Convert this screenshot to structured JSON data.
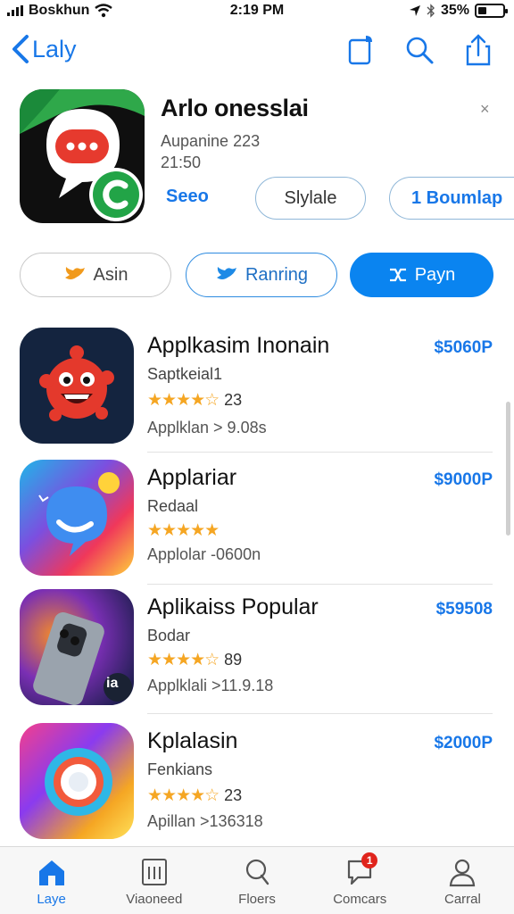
{
  "status_bar": {
    "carrier": "Boskhun",
    "time": "2:19 PM",
    "battery": "35%",
    "battery_level": 0.35,
    "icons": [
      "signal-icon",
      "wifi-icon",
      "location-icon",
      "bluetooth-icon",
      "battery-icon"
    ]
  },
  "nav": {
    "back_label": "Laly",
    "icons": [
      "compose-icon",
      "search-icon",
      "share-icon"
    ]
  },
  "hero": {
    "title": "Arlo onesslai",
    "subtitle_line1": "Aupanine 223",
    "subtitle_line2": "21:50",
    "see_label": "Seeo",
    "style_label": "Slylale",
    "third_label": "1 Boumlap",
    "dismiss": "×"
  },
  "segments": [
    {
      "label": "Asin",
      "icon": "bird-icon"
    },
    {
      "label": "Ranring",
      "icon": "bird-icon"
    },
    {
      "label": "Payn",
      "icon": "shuffle-icon"
    }
  ],
  "apps": [
    {
      "title": "Applkasim Inonain",
      "subtitle": "Saptkeial1",
      "stars": "★★★★☆",
      "rating": 4,
      "reviews": "23",
      "meta": "Applklan > 9.08s",
      "price": "$5060P"
    },
    {
      "title": "Applariar",
      "subtitle": "Redaal",
      "stars": "★★★★★",
      "rating": 5,
      "reviews": "",
      "meta": "Applolar -0600n",
      "price": "$9000P"
    },
    {
      "title": "Aplikaiss Popular",
      "subtitle": "Bodar",
      "stars": "★★★★☆",
      "rating": 4,
      "reviews": "89",
      "meta": "Applklali >11.9.18",
      "price": "$59508",
      "icon_label": "ia"
    },
    {
      "title": "Kplalasin",
      "subtitle": "Fenkians",
      "stars": "★★★★☆",
      "rating": 4,
      "reviews": "23",
      "meta": "Apillan >136318",
      "price": "$2000P"
    }
  ],
  "tabs": [
    {
      "label": "Laye",
      "icon": "home-icon",
      "active": true
    },
    {
      "label": "Viaoneed",
      "icon": "grid-icon",
      "active": false
    },
    {
      "label": "Floers",
      "icon": "search-icon",
      "active": false
    },
    {
      "label": "Comcars",
      "icon": "chat-icon",
      "active": false,
      "badge": "1"
    },
    {
      "label": "Carral",
      "icon": "person-icon",
      "active": false
    }
  ],
  "colors": {
    "accent": "#1877e8",
    "star": "#f5a623",
    "primary_button": "#0a84f0",
    "badge": "#e0241c"
  }
}
